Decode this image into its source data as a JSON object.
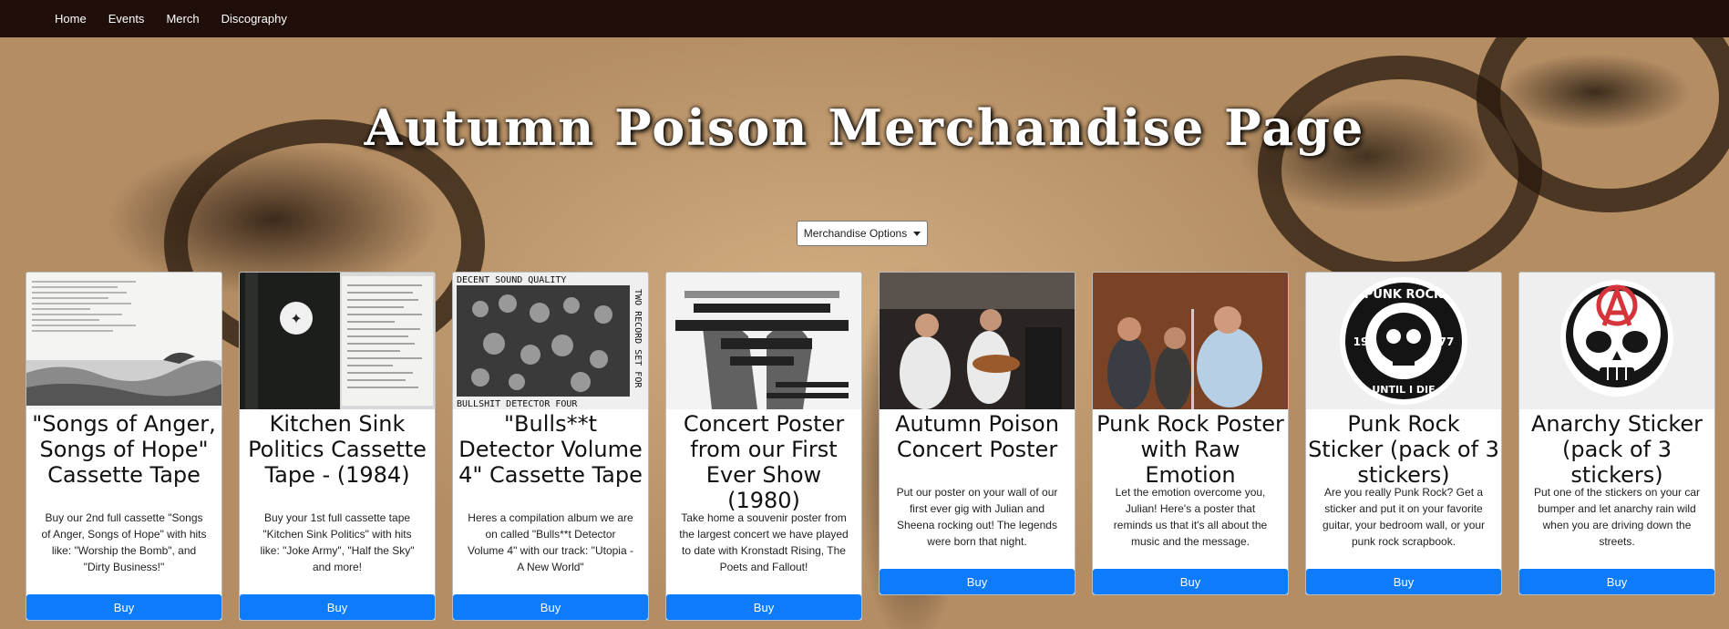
{
  "nav": {
    "items": [
      {
        "label": "Home"
      },
      {
        "label": "Events"
      },
      {
        "label": "Merch"
      },
      {
        "label": "Discography"
      }
    ]
  },
  "page": {
    "title": "Autumn Poison Merchandise Page"
  },
  "dropdown": {
    "label": "Merchandise Options"
  },
  "cards": [
    {
      "title": "\"Songs of Anger, Songs of Hope\" Cassette Tape",
      "description": "Buy our 2nd full cassette \"Songs of Anger, Songs of Hope\" with hits like: \"Worship the Bomb\", and \"Dirty Business!\"",
      "button": "Buy"
    },
    {
      "title": "Kitchen Sink Politics Cassette Tape - (1984)",
      "description": "Buy your 1st full cassette tape \"Kitchen Sink Politics\" with hits like: \"Joke Army\", \"Half the Sky\" and more!",
      "button": "Buy"
    },
    {
      "title": "\"Bulls**t Detector Volume 4\" Cassette Tape",
      "description": "Heres a compilation album we are on called \"Bulls**t Detector Volume 4\" with our track: \"Utopia - A New World\"",
      "button": "Buy"
    },
    {
      "title": "Concert Poster from our First Ever Show (1980)",
      "description": "Take home a souvenir poster from the largest concert we have played to date with Kronstadt Rising, The Poets and Fallout!",
      "button": "Buy"
    },
    {
      "title": "Autumn Poison Concert Poster",
      "description": "Put our poster on your wall of our first ever gig with Julian and Sheena rocking out! The legends were born that night.",
      "button": "Buy"
    },
    {
      "title": "Punk Rock Poster with Raw Emotion",
      "description": "Let the emotion overcome you, Julian! Here's a poster that reminds us that it's all about the music and the message.",
      "button": "Buy"
    },
    {
      "title": "Punk Rock Sticker (pack of 3 stickers)",
      "description": "Are you really Punk Rock? Get a sticker and put it on your favorite guitar, your bedroom wall, or your punk rock scrapbook.",
      "button": "Buy"
    },
    {
      "title": "Anarchy Sticker (pack of 3 stickers)",
      "description": "Put one of the stickers on your car bumper and let anarchy rain wild when you are driving down the streets.",
      "button": "Buy"
    }
  ],
  "images": {
    "cassette_insert_1": {
      "text": ""
    },
    "cassette_insert_2": {
      "text": ""
    },
    "compilation_cover": {
      "top_text": "DECENT SOUND QUALITY",
      "side_text": "TWO RECORD SET FOR",
      "bottom_text": "BULLSHIT DETECTOR FOUR"
    },
    "sticker_punk": {
      "top": "PUNK ROCK",
      "left": "19",
      "right": "77",
      "bottom": "UNTIL I DIE"
    }
  }
}
